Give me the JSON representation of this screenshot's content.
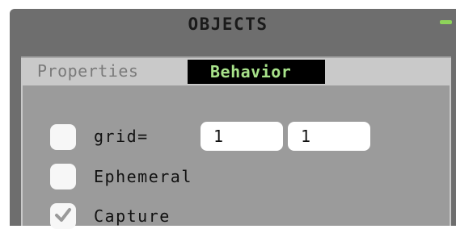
{
  "panel": {
    "title": "OBJECTS",
    "accent_color": "#8ed35a"
  },
  "tabs": [
    {
      "label": "Properties",
      "active": false
    },
    {
      "label": "Behavior",
      "active": true
    }
  ],
  "behavior": {
    "grid": {
      "label": "grid=",
      "checked": false,
      "x": "1",
      "y": "1"
    },
    "ephemeral": {
      "label": "Ephemeral",
      "checked": false
    },
    "capture": {
      "label": "Capture",
      "checked": true
    }
  }
}
